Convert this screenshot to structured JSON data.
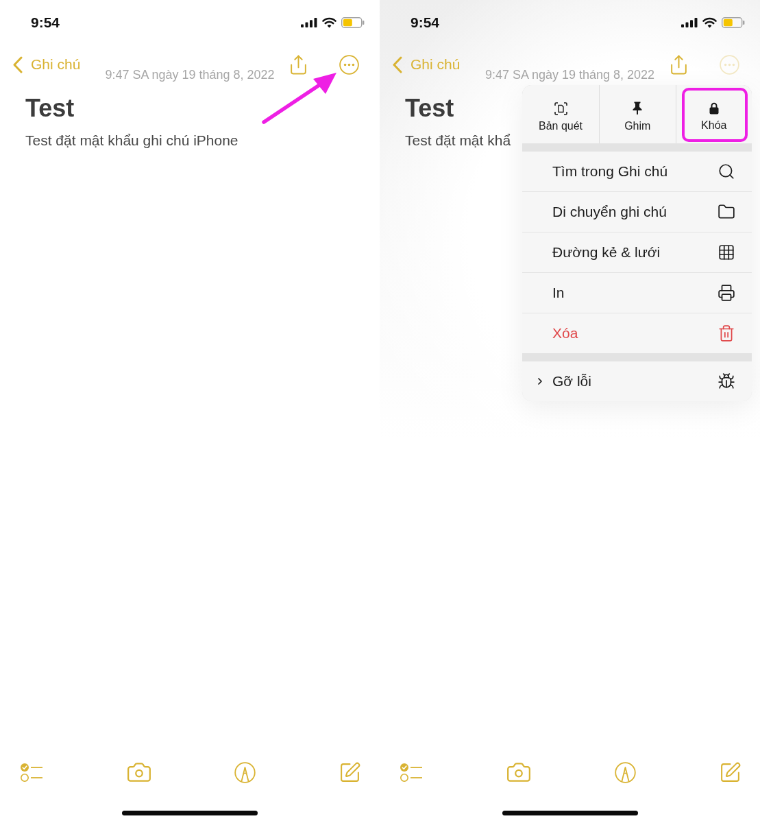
{
  "screens": [
    {
      "status_bar": {
        "time": "9:54"
      },
      "nav": {
        "back_label": "Ghi chú",
        "more_dimmed": false,
        "more_pointed": true
      },
      "date": "9:47 SA ngày 19 tháng 8, 2022",
      "note": {
        "title": "Test",
        "body": "Test đặt mật khẩu ghi chú iPhone"
      }
    },
    {
      "status_bar": {
        "time": "9:54"
      },
      "nav": {
        "back_label": "Ghi chú",
        "more_dimmed": true
      },
      "date": "9:47 SA ngày 19 tháng 8, 2022",
      "note": {
        "title": "Test",
        "body": "Test đặt mật khẩ"
      },
      "menu": {
        "quick_actions": [
          {
            "label": "Bản quét",
            "highlighted": false
          },
          {
            "label": "Ghim",
            "highlighted": false
          },
          {
            "label": "Khóa",
            "highlighted": true
          }
        ],
        "sections": [
          {
            "items": [
              {
                "label": "Tìm trong Ghi chú",
                "kind": "action"
              },
              {
                "label": "Di chuyển ghi chú",
                "kind": "action"
              },
              {
                "label": "Đường kẻ & lưới",
                "kind": "action"
              },
              {
                "label": "In",
                "kind": "action"
              },
              {
                "label": "Xóa",
                "kind": "destructive"
              }
            ]
          },
          {
            "items": [
              {
                "label": "Gỡ lỗi",
                "kind": "submenu"
              }
            ]
          }
        ]
      }
    }
  ]
}
